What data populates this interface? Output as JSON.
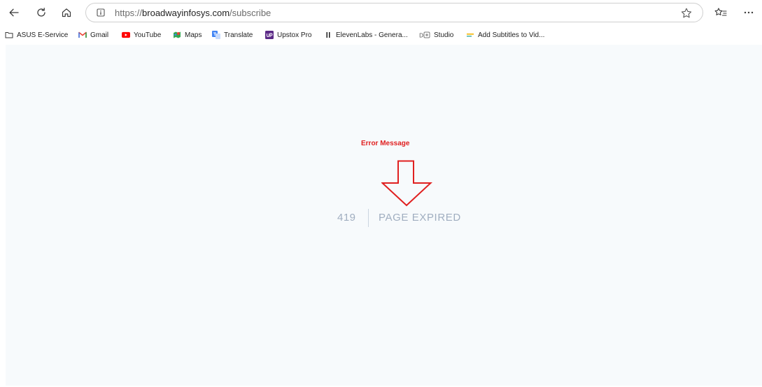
{
  "browser": {
    "url_scheme": "https://",
    "url_domain": "broadwayinfosys.com",
    "url_path": "/subscribe",
    "icons": {
      "back": "back-arrow-icon",
      "refresh": "refresh-icon",
      "home": "home-icon",
      "site_info": "site-info-icon",
      "favorite": "star-icon",
      "favorites": "favorites-icon",
      "menu": "more-icon"
    }
  },
  "bookmarks": [
    {
      "label": "ASUS E-Service",
      "icon": "folder-icon"
    },
    {
      "label": "Gmail",
      "icon": "gmail-icon"
    },
    {
      "label": "YouTube",
      "icon": "youtube-icon"
    },
    {
      "label": "Maps",
      "icon": "maps-icon"
    },
    {
      "label": "Translate",
      "icon": "translate-icon"
    },
    {
      "label": "Upstox Pro",
      "icon": "upstox-icon"
    },
    {
      "label": "ElevenLabs - Genera...",
      "icon": "elevenlabs-icon"
    },
    {
      "label": "Studio",
      "icon": "studio-icon"
    },
    {
      "label": "Add Subtitles to Vid...",
      "icon": "subtitles-icon"
    }
  ],
  "page": {
    "annotation": "Error Message",
    "error_code": "419",
    "error_message": "PAGE EXPIRED",
    "colors": {
      "annotation": "#e02020",
      "background": "#f7fafc",
      "error_text": "#a0aec0"
    }
  }
}
